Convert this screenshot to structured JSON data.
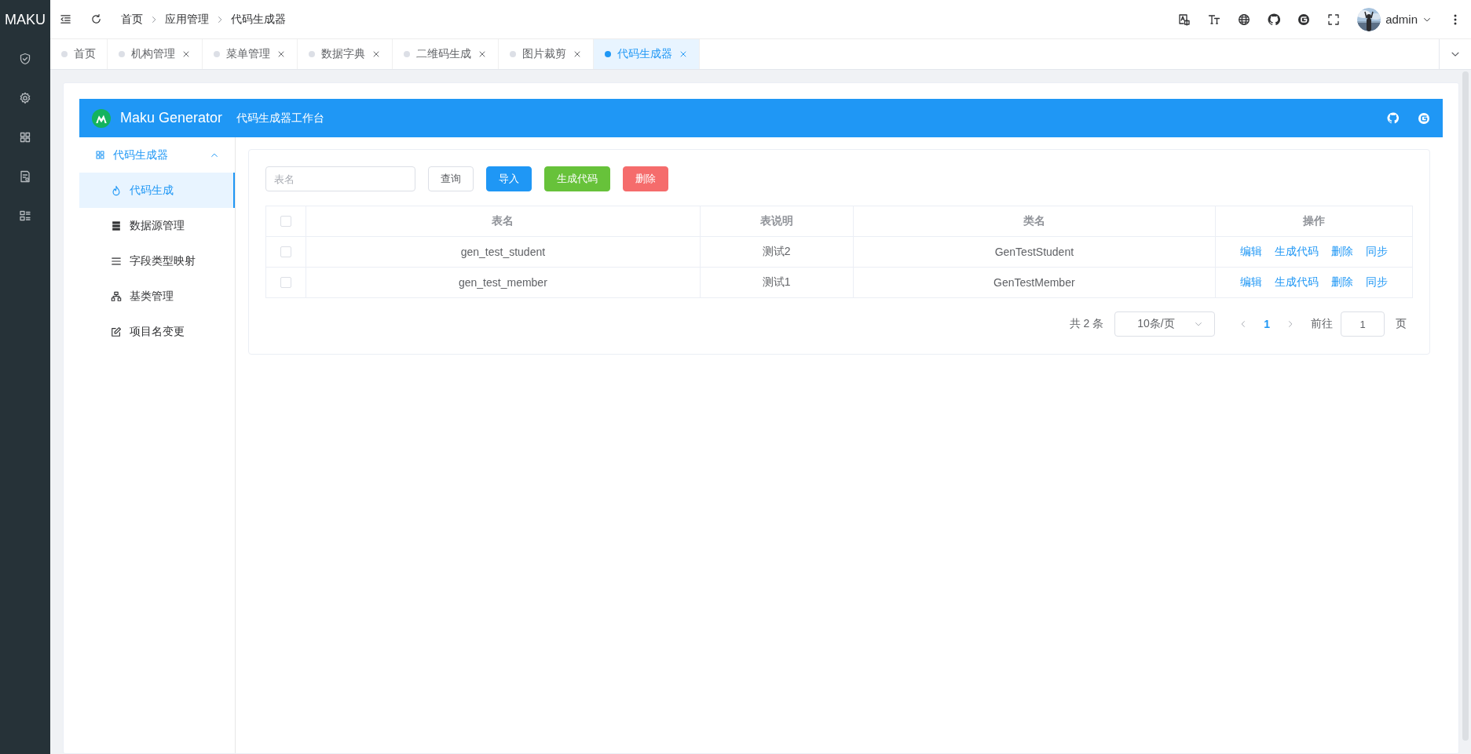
{
  "sidebar": {
    "brand": "MAKU"
  },
  "header": {
    "breadcrumb": [
      "首页",
      "应用管理",
      "代码生成器"
    ],
    "user": "admin"
  },
  "tabs": [
    {
      "label": "首页",
      "selected": false,
      "closable": false
    },
    {
      "label": "机构管理",
      "selected": false,
      "closable": true
    },
    {
      "label": "菜单管理",
      "selected": false,
      "closable": true
    },
    {
      "label": "数据字典",
      "selected": false,
      "closable": true
    },
    {
      "label": "二维码生成",
      "selected": false,
      "closable": true
    },
    {
      "label": "图片裁剪",
      "selected": false,
      "closable": true
    },
    {
      "label": "代码生成器",
      "selected": true,
      "closable": true
    }
  ],
  "generator": {
    "title": "Maku Generator",
    "subtitle": "代码生成器工作台",
    "nav": {
      "label": "代码生成器",
      "expanded": true,
      "children": [
        {
          "label": "代码生成",
          "selected": true
        },
        {
          "label": "数据源管理",
          "selected": false
        },
        {
          "label": "字段类型映射",
          "selected": false
        },
        {
          "label": "基类管理",
          "selected": false
        },
        {
          "label": "项目名变更",
          "selected": false
        }
      ]
    }
  },
  "toolbar": {
    "search": {
      "placeholder": "表名"
    },
    "buttons": [
      {
        "label": "查询",
        "kind": "default"
      },
      {
        "label": "导入",
        "kind": "primary"
      },
      {
        "label": "生成代码",
        "kind": "success"
      },
      {
        "label": "删除",
        "kind": "danger"
      }
    ]
  },
  "table": {
    "all_checked": false,
    "columns": [
      "表名",
      "表说明",
      "类名",
      "操作"
    ],
    "rows": [
      {
        "checked": false,
        "cells": [
          "gen_test_student",
          "测试2",
          "GenTestStudent"
        ],
        "actions": [
          "编辑",
          "生成代码",
          "删除",
          "同步"
        ]
      },
      {
        "checked": false,
        "cells": [
          "gen_test_member",
          "测试1",
          "GenTestMember"
        ],
        "actions": [
          "编辑",
          "生成代码",
          "删除",
          "同步"
        ]
      }
    ]
  },
  "pagination": {
    "total": "共 2 条",
    "page_size": "10条/页",
    "pages": [
      {
        "label": "1",
        "selected": true
      }
    ],
    "goto_label": "前往",
    "goto_value": "1",
    "page_suffix": "页"
  }
}
